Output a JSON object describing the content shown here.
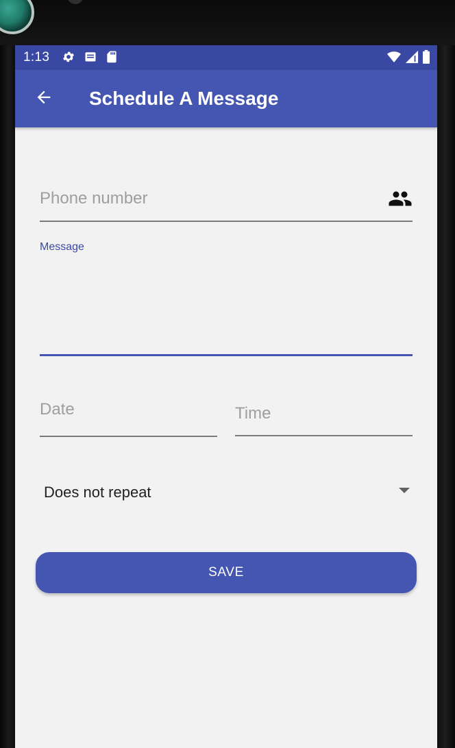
{
  "status_bar": {
    "time": "1:13",
    "left_icons": [
      "settings-gear-icon",
      "notification-card-icon",
      "sd-card-icon"
    ],
    "right_icons": [
      "wifi-icon",
      "signal-icon",
      "battery-icon"
    ],
    "color": "#3949a3"
  },
  "app_bar": {
    "title": "Schedule A Message",
    "back_icon": "arrow-back-icon",
    "color": "#4556b2"
  },
  "form": {
    "phone": {
      "placeholder": "Phone number",
      "value": "",
      "contacts_icon": "contacts-people-icon"
    },
    "message": {
      "label": "Message",
      "value": ""
    },
    "date": {
      "placeholder": "Date",
      "value": ""
    },
    "time": {
      "placeholder": "Time",
      "value": ""
    },
    "repeat": {
      "selected": "Does not repeat"
    },
    "save_label": "SAVE"
  },
  "colors": {
    "accent": "#4556b2",
    "background": "#f2f2f2",
    "placeholder": "#9e9e9e"
  }
}
